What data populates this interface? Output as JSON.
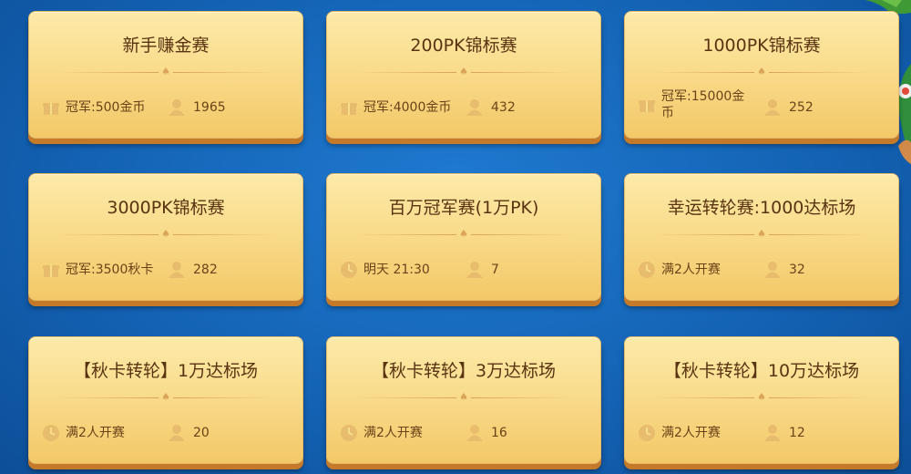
{
  "cards": [
    {
      "title": "新手赚金赛",
      "prize": "冠军:500金币",
      "left_icon": "gift-icon",
      "players": "1965"
    },
    {
      "title": "200PK锦标赛",
      "prize": "冠军:4000金币",
      "left_icon": "gift-icon",
      "players": "432"
    },
    {
      "title": "1000PK锦标赛",
      "prize": "冠军:15000金币",
      "left_icon": "gift-icon",
      "players": "252"
    },
    {
      "title": "3000PK锦标赛",
      "prize": "冠军:3500秋卡",
      "left_icon": "gift-icon",
      "players": "282"
    },
    {
      "title": "百万冠军赛(1万PK)",
      "prize": "明天 21:30",
      "left_icon": "clock-icon",
      "players": "7"
    },
    {
      "title": "幸运转轮赛:1000达标场",
      "prize": "满2人开赛",
      "left_icon": "clock-icon",
      "players": "32"
    },
    {
      "title": "【秋卡转轮】1万达标场",
      "prize": "满2人开赛",
      "left_icon": "clock-icon",
      "players": "20"
    },
    {
      "title": "【秋卡转轮】3万达标场",
      "prize": "满2人开赛",
      "left_icon": "clock-icon",
      "players": "16"
    },
    {
      "title": "【秋卡转轮】10万达标场",
      "prize": "满2人开赛",
      "left_icon": "clock-icon",
      "players": "12"
    }
  ],
  "colors": {
    "card_top": "#fdeaa9",
    "card_bottom": "#f3c868",
    "text": "#5a3412",
    "background": "#1463b5"
  }
}
